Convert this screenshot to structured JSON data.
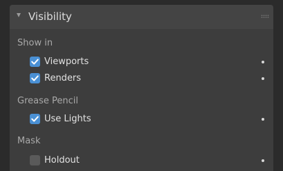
{
  "panel": {
    "title": "Visibility",
    "expanded": true
  },
  "sections": {
    "show_in": {
      "label": "Show in",
      "items": [
        {
          "label": "Viewports",
          "checked": true
        },
        {
          "label": "Renders",
          "checked": true
        }
      ]
    },
    "grease_pencil": {
      "label": "Grease Pencil",
      "items": [
        {
          "label": "Use Lights",
          "checked": true
        }
      ]
    },
    "mask": {
      "label": "Mask",
      "items": [
        {
          "label": "Holdout",
          "checked": false
        }
      ]
    }
  },
  "colors": {
    "checkbox_checked": "#4a90d4",
    "checkbox_unchecked": "#5a5a5a",
    "panel_bg": "#3d3d3d",
    "header_bg": "#444444"
  },
  "icons": {
    "collapse": "triangle-down-icon",
    "drag": "drag-handle-icon",
    "keyframe": "keyframe-dot-icon",
    "check": "checkmark-icon"
  }
}
